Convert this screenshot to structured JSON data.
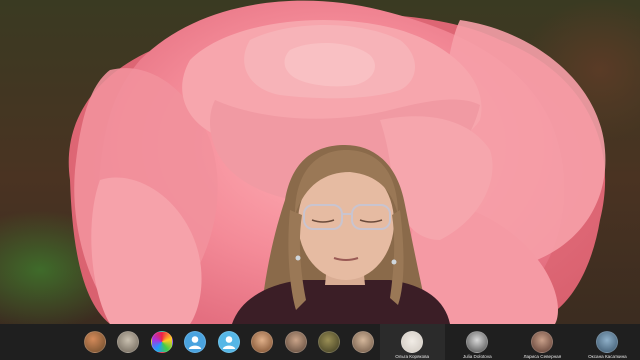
{
  "participants": [
    {
      "avatar": "photo-avatar-1",
      "name": ""
    },
    {
      "avatar": "photo-avatar-2",
      "name": ""
    },
    {
      "avatar": "colorful-avatar-3",
      "name": ""
    },
    {
      "avatar": "user-placeholder-avatar-4",
      "name": ""
    },
    {
      "avatar": "user-placeholder-avatar-5",
      "name": ""
    },
    {
      "avatar": "photo-avatar-6",
      "name": ""
    },
    {
      "avatar": "photo-avatar-7",
      "name": ""
    },
    {
      "avatar": "photo-avatar-8",
      "name": ""
    },
    {
      "avatar": "photo-avatar-9",
      "name": ""
    },
    {
      "avatar": "photo-avatar-10",
      "name": "Ольга Корякова"
    },
    {
      "avatar": "photo-avatar-11",
      "name": "Julia Dolotova"
    },
    {
      "avatar": "photo-avatar-12",
      "name": "Лариса Северная"
    },
    {
      "avatar": "photo-avatar-13",
      "name": "Оксана Касаткина"
    }
  ],
  "colors": {
    "bar_background": "#1f1f1f",
    "rose_pink": "#f58f9a",
    "avatar_blue": "#4aa3df"
  }
}
